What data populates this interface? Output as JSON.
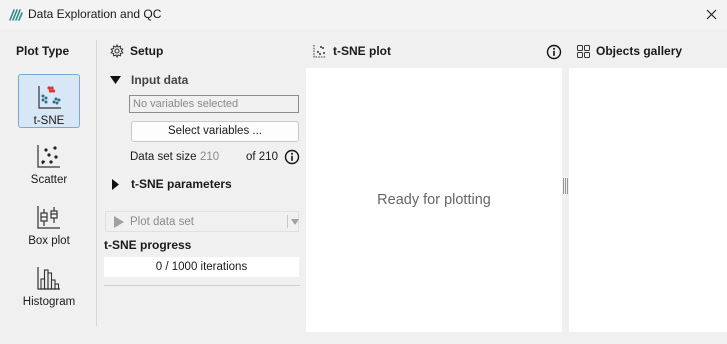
{
  "window": {
    "title": "Data Exploration and QC",
    "app_icon": "app-logo-icon",
    "close_icon": "close-icon"
  },
  "plot_type": {
    "header": "Plot Type",
    "items": [
      {
        "label": "t-SNE",
        "icon": "tsne-plot-icon",
        "active": true
      },
      {
        "label": "Scatter",
        "icon": "scatter-plot-icon",
        "active": false
      },
      {
        "label": "Box plot",
        "icon": "box-plot-icon",
        "active": false
      },
      {
        "label": "Histogram",
        "icon": "histogram-icon",
        "active": false
      }
    ]
  },
  "setup": {
    "header": "Setup",
    "icon": "gear-icon",
    "input_data": {
      "label": "Input data",
      "expanded": true,
      "variables_placeholder": "No variables selected",
      "select_button": "Select variables ...",
      "data_set_size_label": "Data set size",
      "data_set_size_value": "210",
      "data_set_size_of": "of 210"
    },
    "tsne_parameters": {
      "label": "t-SNE parameters",
      "expanded": false
    },
    "plot_button": "Plot data set",
    "progress": {
      "title": "t-SNE progress",
      "text": "0 / 1000 iterations"
    }
  },
  "plot": {
    "header": "t-SNE plot",
    "placeholder": "Ready for plotting"
  },
  "gallery": {
    "header": "Objects gallery"
  },
  "colors": {
    "accent": "#d8e7f6",
    "accent_border": "#7aa9d8",
    "tsne_red": "#e03030",
    "tsne_teal": "#2f6f8a"
  }
}
